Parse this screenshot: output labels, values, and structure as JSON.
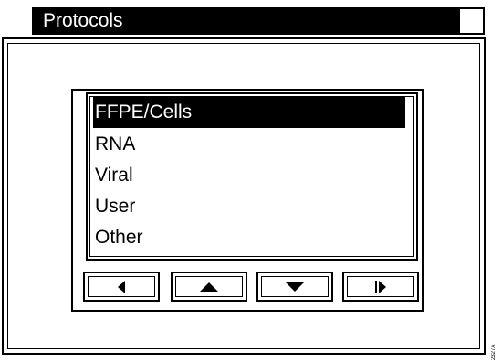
{
  "window": {
    "title": "Protocols"
  },
  "protocol_list": {
    "items": [
      {
        "label": "FFPE/Cells",
        "selected": true
      },
      {
        "label": "RNA",
        "selected": false
      },
      {
        "label": "Viral",
        "selected": false
      },
      {
        "label": "User",
        "selected": false
      },
      {
        "label": "Other",
        "selected": false
      }
    ]
  },
  "nav_buttons": [
    {
      "icon": "triangle-left-icon"
    },
    {
      "icon": "triangle-up-icon"
    },
    {
      "icon": "triangle-down-icon"
    },
    {
      "icon": "bar-triangle-right-icon"
    }
  ],
  "figure_tag": "2327A",
  "colors": {
    "foreground": "#000000",
    "background": "#ffffff"
  }
}
